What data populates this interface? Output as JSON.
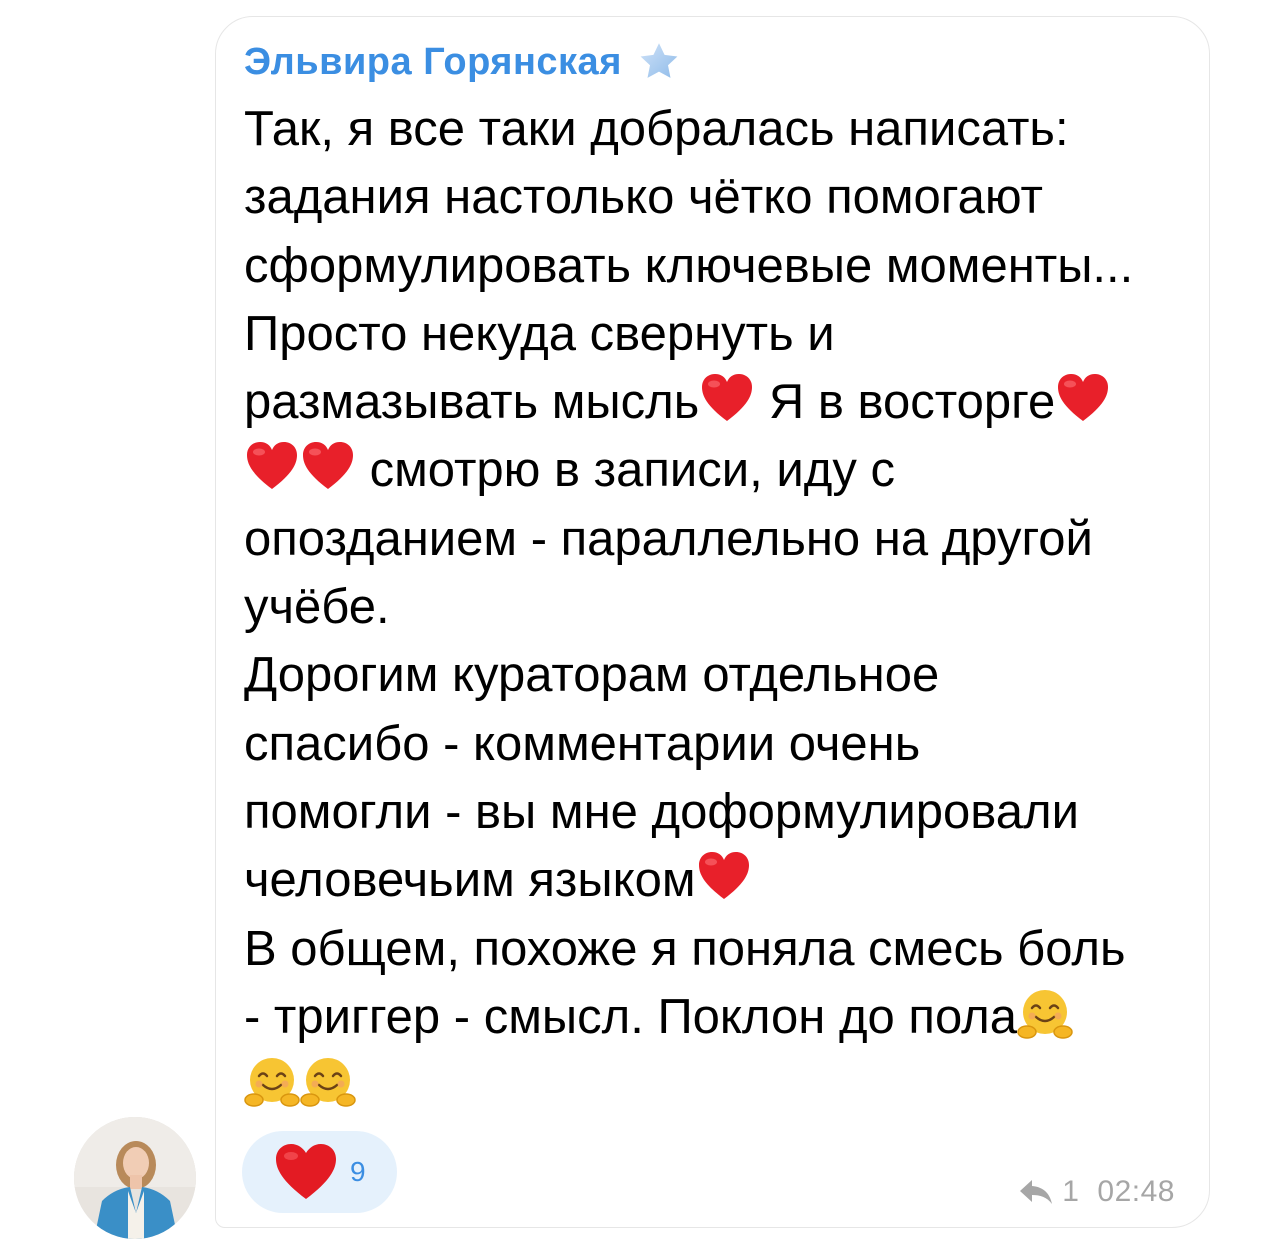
{
  "message": {
    "sender_name": "Эльвира Горянская",
    "sender_badge_icon": "star-icon",
    "lines": [
      {
        "segments": [
          {
            "t": "text",
            "v": "Так, я все таки добралась написать:"
          }
        ]
      },
      {
        "segments": [
          {
            "t": "text",
            "v": "задания настолько чётко помогают"
          }
        ]
      },
      {
        "segments": [
          {
            "t": "text",
            "v": "сформулировать ключевые моменты..."
          }
        ]
      },
      {
        "segments": [
          {
            "t": "text",
            "v": "Просто некуда свернуть и"
          }
        ]
      },
      {
        "segments": [
          {
            "t": "text",
            "v": "размазывать мысль"
          },
          {
            "t": "emoji",
            "v": "heart"
          },
          {
            "t": "text",
            "v": " Я в восторге"
          },
          {
            "t": "emoji",
            "v": "heart"
          }
        ]
      },
      {
        "segments": [
          {
            "t": "emoji",
            "v": "heart"
          },
          {
            "t": "emoji",
            "v": "heart"
          },
          {
            "t": "text",
            "v": " смотрю в записи, иду с"
          }
        ]
      },
      {
        "segments": [
          {
            "t": "text",
            "v": "опозданием - параллельно на другой"
          }
        ]
      },
      {
        "segments": [
          {
            "t": "text",
            "v": "учёбе."
          }
        ]
      },
      {
        "segments": [
          {
            "t": "text",
            "v": "Дорогим кураторам отдельное"
          }
        ]
      },
      {
        "segments": [
          {
            "t": "text",
            "v": "спасибо - комментарии очень"
          }
        ]
      },
      {
        "segments": [
          {
            "t": "text",
            "v": "помогли - вы мне доформулировали"
          }
        ]
      },
      {
        "segments": [
          {
            "t": "text",
            "v": "человечьим языком"
          },
          {
            "t": "emoji",
            "v": "heart"
          }
        ]
      },
      {
        "segments": [
          {
            "t": "text",
            "v": "В общем, похоже я поняла смесь боль"
          }
        ]
      },
      {
        "segments": [
          {
            "t": "text",
            "v": "- триггер - смысл. Поклон до пола"
          },
          {
            "t": "emoji",
            "v": "hug"
          }
        ]
      },
      {
        "segments": [
          {
            "t": "emoji",
            "v": "hug"
          },
          {
            "t": "emoji",
            "v": "hug"
          }
        ]
      }
    ],
    "reaction": {
      "icon": "heart-icon",
      "count": "9"
    },
    "reply_icon": "reply-arrow-icon",
    "reply_count": "1",
    "time": "02:48"
  },
  "colors": {
    "sender": "#3b8ee2",
    "reaction_bg": "#e5f1fc",
    "meta": "#a6a6a6",
    "heart": "#e8202a"
  }
}
